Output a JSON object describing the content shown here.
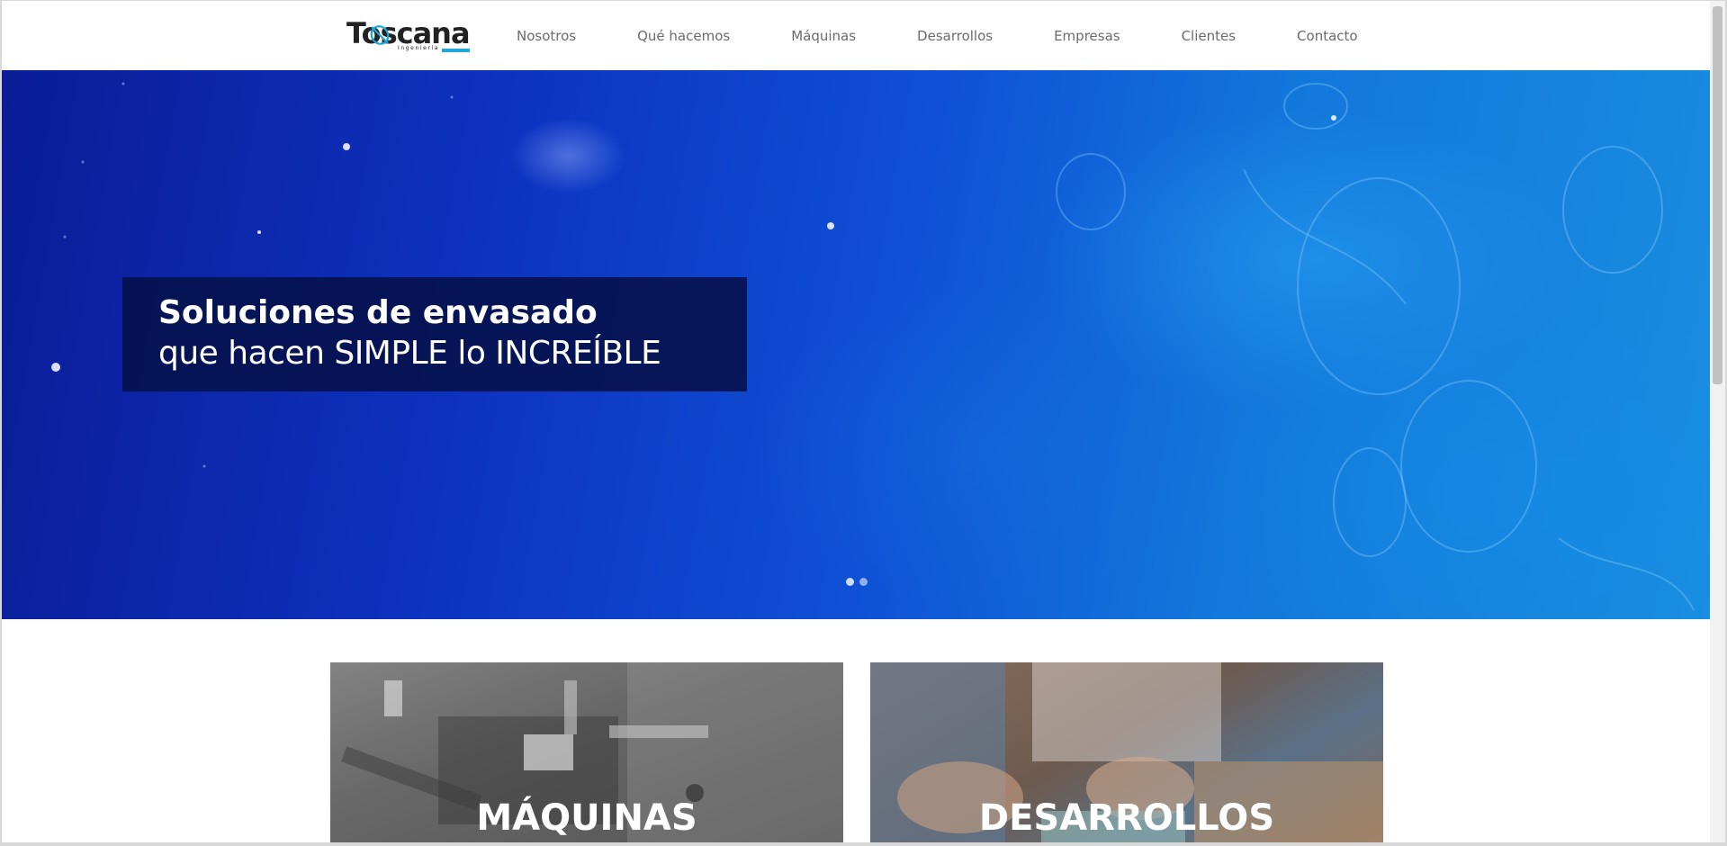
{
  "header": {
    "logo": {
      "text": "Toscana",
      "subtext": "Ingeniería"
    },
    "nav": [
      "Nosotros",
      "Qué hacemos",
      "Máquinas",
      "Desarrollos",
      "Empresas",
      "Clientes",
      "Contacto"
    ]
  },
  "hero": {
    "title": "Soluciones de envasado",
    "subtitle": "que hacen SIMPLE lo INCREÍBLE",
    "slides_total": 2,
    "active_slide": 1
  },
  "cards": {
    "maquinas": {
      "label": "MÁQUINAS"
    },
    "desarrollos": {
      "label": "DESARROLLOS"
    }
  },
  "colors": {
    "brand_accent": "#1ea7d8",
    "nav_text": "#6b6b6b",
    "hero_box": "#05124e",
    "hero_blue": "#0d32bf"
  },
  "icons": [
    "toscana-logo-icon",
    "slider-dot-icon"
  ]
}
